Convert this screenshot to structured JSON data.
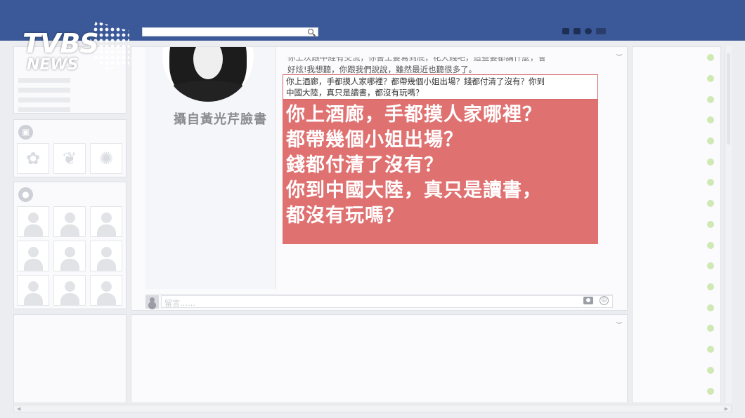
{
  "logo": {
    "brand": "TVBS",
    "sub": "NEWS"
  },
  "search": {
    "placeholder": ""
  },
  "post": {
    "photo_caption": "攝自黃光芹臉書",
    "text_line_1": "你上次跟中經有交流，你書上要寫到底，花大錢吧，這些要都講什麼，會",
    "text_line_2": "好炫!我想聽，你跟我們說說，雖然最近也聽很多了。",
    "quote_line_1": "你上酒廊，手都摸人家哪裡？都帶幾個小姐出場？錢都付清了沒有？你到",
    "quote_line_2": "中國大陸，真只是讀書，都沒有玩嗎？",
    "highlight_lines": [
      "你上酒廊，手都摸人家哪裡？",
      "都帶幾個小姐出場？",
      "錢都付清了沒有？",
      "你到中國大陸，真只是讀書，",
      "都沒有玩嗎？"
    ],
    "comment_placeholder": "留言……"
  },
  "icons": {
    "left_photos": "photo-icon",
    "left_friends": "friends-icon",
    "thumbs": [
      "butterfly-icon",
      "leaf-icon",
      "flower-icon"
    ]
  },
  "colors": {
    "topbar": "#3b5998",
    "highlight_bg": "#e07171",
    "online_dot": "#cfe8b4"
  }
}
